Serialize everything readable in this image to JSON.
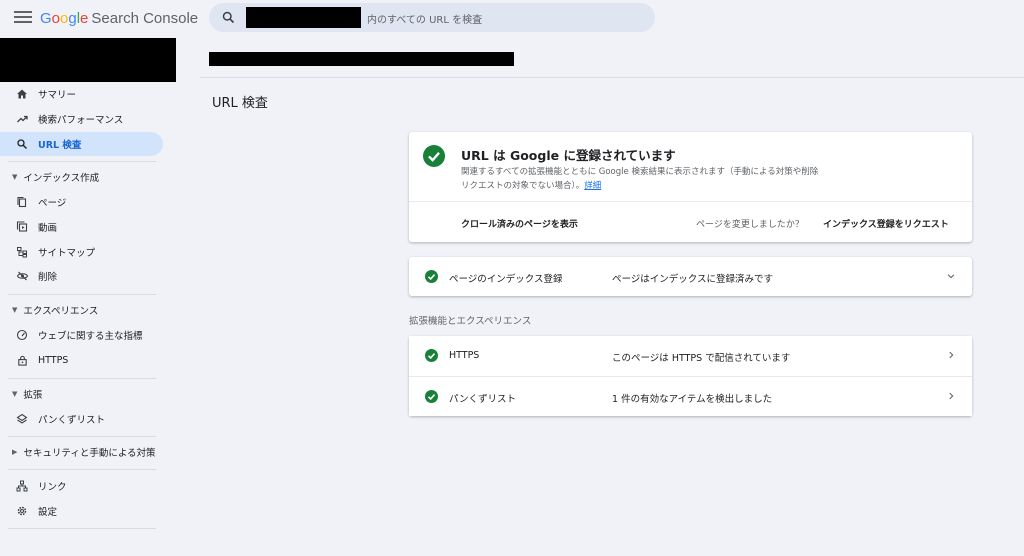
{
  "header": {
    "logo_letters": [
      "G",
      "o",
      "o",
      "g",
      "l",
      "e"
    ],
    "logo_suffix": "Search Console",
    "search_placeholder": "内のすべての URL を検査"
  },
  "sidebar": {
    "items_top": [
      {
        "label": "サマリー",
        "icon": "home-icon"
      },
      {
        "label": "検索パフォーマンス",
        "icon": "trending-icon"
      },
      {
        "label": "URL 検査",
        "icon": "search-icon",
        "active": true
      }
    ],
    "section_index": "インデックス作成",
    "items_index": [
      {
        "label": "ページ",
        "icon": "pages-icon"
      },
      {
        "label": "動画",
        "icon": "video-icon"
      },
      {
        "label": "サイトマップ",
        "icon": "sitemap-icon"
      },
      {
        "label": "削除",
        "icon": "removal-icon"
      }
    ],
    "section_experience": "エクスペリエンス",
    "items_experience": [
      {
        "label": "ウェブに関する主な指標",
        "icon": "speed-icon"
      },
      {
        "label": "HTTPS",
        "icon": "lock-icon"
      }
    ],
    "section_enhancements": "拡張",
    "items_enhancements": [
      {
        "label": "パンくずリスト",
        "icon": "layers-icon"
      }
    ],
    "section_security": "セキュリティと手動による対策",
    "items_bottom": [
      {
        "label": "リンク",
        "icon": "links-icon"
      },
      {
        "label": "設定",
        "icon": "settings-icon"
      }
    ]
  },
  "main": {
    "page_title": "URL 検査",
    "status_card": {
      "title": "URL は Google に登録されています",
      "description": "関連するすべての拡張機能とともに Google 検索結果に表示されます（手動による対策や削除リクエストの対象でない場合）。",
      "details_link": "詳細",
      "crawl_button": "クロール済みのページを表示",
      "changed_question": "ページを変更しましたか？",
      "request_button": "インデックス登録をリクエスト"
    },
    "indexing_row": {
      "label": "ページのインデックス登録",
      "value": "ページはインデックスに登録済みです"
    },
    "enhancements_label": "拡張機能とエクスペリエンス",
    "enhancement_rows": [
      {
        "label": "HTTPS",
        "value": "このページは HTTPS で配信されています"
      },
      {
        "label": "パンくずリスト",
        "value": "1 件の有効なアイテムを検出しました"
      }
    ]
  },
  "colors": {
    "accent_blue": "#1a73e8",
    "success_green": "#188038",
    "active_nav_bg": "#d2e3fc",
    "page_bg": "#f0f2f7"
  }
}
